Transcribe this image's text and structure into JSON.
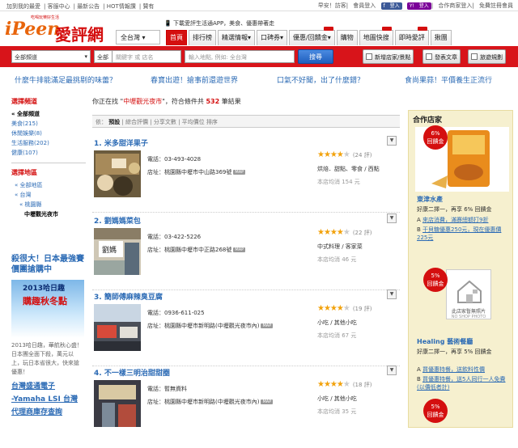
{
  "topbar": {
    "links": [
      "加到我的最愛",
      "客服中心",
      "最新公告",
      "HOT情報讚",
      "贊有"
    ],
    "greeting": "早安！訪客",
    "login": "會員登入",
    "fb": "登入",
    "yahoo": "登入",
    "partner": "合作商家登入",
    "register": "免費註冊會員"
  },
  "logo": {
    "brand": "iPeen",
    "cn": "愛評網",
    "tag": "吃喝玩樂好生活"
  },
  "app_download": "下載愛評生活通APP，美食、優惠帶著走",
  "nav": {
    "city": "全台灣",
    "tabs": [
      "首頁",
      "排行榜",
      "精選情報",
      "口碑券",
      "優惠/回饋金",
      "購物",
      "地圖快搜",
      "即時愛評",
      "揪團"
    ]
  },
  "search": {
    "channel": "全部頻道",
    "scope": "全部",
    "keyword_placeholder": "關鍵字 或 店名",
    "location_placeholder": "輸入地點, 例如: 全台灣",
    "button": "搜尋",
    "add_shop": "新增店家/景點",
    "post_article": "發表文章",
    "trip": "旅遊規劃"
  },
  "promo": [
    "什麼牛排能滿足最挑剔的味蕾？",
    "春寶出遊！搶事前還遊世界",
    "口氣不好聞，出了什麼錯？",
    "食尚果蒜！平價養生正流行"
  ],
  "sidebar": {
    "channel_title": "選擇頻道",
    "channels": [
      "« 全部頻道",
      "美食(215)",
      "休閒娛樂(8)",
      "生活服務(202)",
      "健康(107)"
    ],
    "region_title": "選擇地區",
    "regions": [
      "« 全部地區",
      "« 台灣",
      "« 桃園縣",
      "中壢觀光夜市"
    ],
    "ad_headline": "殺很大！日本最強賽價團搶購中",
    "ad_banner_top": "2013哈日趣",
    "ad_banner_main": "購趣秋冬點",
    "ad_text": "2013哈日趣，華航秋心盛！日本團全面下殺，萬元以上，玩日本省很大，快來搶優惠！",
    "ad2": [
      "台灣盛通電子",
      "-Yamaha LSI 台灣",
      "代理商庫存查詢"
    ]
  },
  "main": {
    "found_prefix": "你正在找 \"",
    "keyword": "中壢觀光夜市",
    "found_mid": "\"，符合條件共",
    "count": "532",
    "found_suffix": "筆結果",
    "sort_label": "依：",
    "sort_options": [
      "預設",
      "綜合評價",
      "分享文數",
      "平均價位",
      "排序"
    ],
    "shops": [
      {
        "title": "1. 米多甜洋果子",
        "phone_label": "電話：",
        "phone": "03-493-4028",
        "addr_label": "店址：",
        "addr": "桃園縣中壢市中山路369號",
        "stars": 4.5,
        "reviews": "(24 評)",
        "category": "烘焙．甜點、零食 / 西點",
        "avg": "本店均消 154 元"
      },
      {
        "title": "2. 劉媽媽菜包",
        "phone_label": "電話：",
        "phone": "03-422-5226",
        "addr_label": "店址：",
        "addr": "桃園縣中壢市中正路268號",
        "stars": 4.5,
        "reviews": "(22 評)",
        "category": "中式料理 / 客家菜",
        "avg": "本店均消 46 元"
      },
      {
        "title": "3. 簡師傅麻辣臭豆腐",
        "phone_label": "電話：",
        "phone": "0936-611-025",
        "addr_label": "店址：",
        "addr": "桃園縣中壢市新明路(中壢觀光夜市內)",
        "stars": 4.5,
        "reviews": "(19 評)",
        "category": "小吃 / 其他小吃",
        "avg": "本店均消 67 元"
      },
      {
        "title": "4. 不一樣三明治甜甜圈",
        "phone_label": "電話：",
        "phone": "暫無資料",
        "addr_label": "店址：",
        "addr": "桃園縣中壢市新明路(中壢觀光夜市內)",
        "stars": 4.5,
        "reviews": "(18 評)",
        "category": "小吃 / 其他小吃",
        "avg": "本店均消 35 元"
      }
    ]
  },
  "right": {
    "title": "合作店家",
    "shops": [
      {
        "badge_pct": "6%",
        "badge_label": "回饋金",
        "name": "東津水產",
        "desc": "好康二擇一，再享 6% 回饋金",
        "offers": [
          "來店消費，滿賽總額打9折",
          "干貝糖優惠250元，現在優惠價225元"
        ]
      },
      {
        "badge_pct": "5%",
        "badge_label": "回饋金",
        "no_photo": "此店家暫無照片",
        "name": "Healing 藝術餐廳",
        "desc": "好康二擇一，再享 5% 回饋金",
        "offers": [
          "買優惠特餐，送飲料性價",
          "買優惠特餐，送5人同行一人免費(以價低者計)"
        ]
      },
      {
        "badge_pct": "5%",
        "badge_label": "回饋金"
      }
    ]
  },
  "colors": {
    "brand_red": "#d40f0f",
    "link_blue": "#2c6bb5",
    "star": "#f2a20c"
  }
}
